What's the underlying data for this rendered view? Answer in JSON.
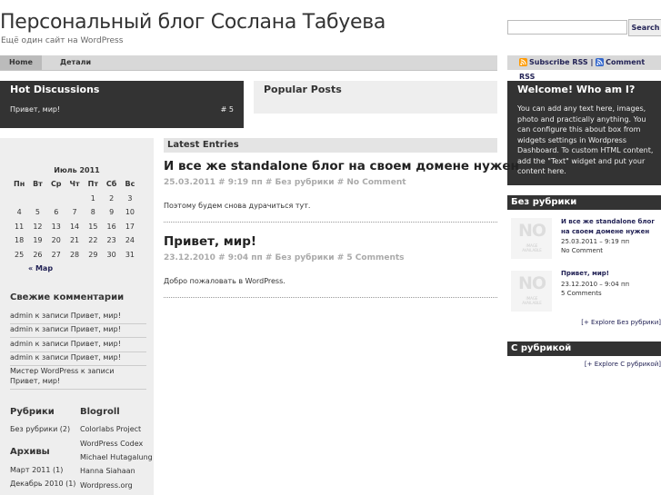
{
  "header": {
    "title": "Персональный блог Сослана Табуева",
    "description": "Ещё один сайт на WordPress"
  },
  "search": {
    "placeholder": "",
    "button": "Search"
  },
  "nav": {
    "items": [
      "Home",
      "Детали"
    ]
  },
  "rss": {
    "subscribe": "Subscribe RSS",
    "separator": "|",
    "comment": "Comment RSS"
  },
  "hot": {
    "title": "Hot Discussions",
    "items": [
      {
        "label": "Привет, мир!",
        "count": "# 5"
      }
    ]
  },
  "popular": {
    "title": "Popular Posts"
  },
  "welcome": {
    "title": "Welcome! Who am I?",
    "text": "You can add any text here, images, photo and practically anything. You can configure this about box from widgets settings in Wordpress Dashboard. To custom HTML content, add the \"Text\" widget and put your content here."
  },
  "calendar": {
    "title": "Июль 2011",
    "weekdays": [
      "Пн",
      "Вт",
      "Ср",
      "Чт",
      "Пт",
      "Сб",
      "Вс"
    ],
    "rows": [
      [
        "",
        "",
        "",
        "",
        "1",
        "2",
        "3"
      ],
      [
        "4",
        "5",
        "6",
        "7",
        "8",
        "9",
        "10"
      ],
      [
        "11",
        "12",
        "13",
        "14",
        "15",
        "16",
        "17"
      ],
      [
        "18",
        "19",
        "20",
        "21",
        "22",
        "23",
        "24"
      ],
      [
        "25",
        "26",
        "27",
        "28",
        "29",
        "30",
        "31"
      ]
    ],
    "prev": "« Мар"
  },
  "recent_comments": {
    "title": "Свежие комментарии",
    "items": [
      "admin к записи Привет, мир!",
      "admin к записи Привет, мир!",
      "admin к записи Привет, мир!",
      "admin к записи Привет, мир!",
      "Мистер WordPress к записи Привет, мир!"
    ]
  },
  "rubrics": {
    "title": "Рубрики",
    "items": [
      "Без рубрики (2)"
    ]
  },
  "archives": {
    "title": "Архивы",
    "items": [
      "Март 2011 (1)",
      "Декабрь 2010 (1)"
    ]
  },
  "blogroll": {
    "title": "Blogroll",
    "items": [
      "Colorlabs Project",
      "WordPress Codex",
      "Michael Hutagalung",
      "Hanna Siahaan",
      "Wordpress.org"
    ]
  },
  "latest": {
    "title": "Latest Entries",
    "posts": [
      {
        "title": "И все же standalone блог на своем домене нужен",
        "meta": "25.03.2011 # 9:19 пп # Без рубрики # No Comment",
        "body": "Поэтому будем снова дурачиться тут."
      },
      {
        "title": "Привет, мир!",
        "meta": "23.12.2010 # 9:04 пп # Без рубрики # 5 Comments",
        "body": "Добро пожаловать в WordPress."
      }
    ]
  },
  "cat1": {
    "title": "Без рубрики",
    "posts": [
      {
        "title": "И все же standalone блог на своем домене нужен",
        "date": "25.03.2011 – 9:19 пп",
        "comments": "No Comment"
      },
      {
        "title": "Привет, мир!",
        "date": "23.12.2010 – 9:04 пп",
        "comments": "5 Comments"
      }
    ],
    "explore": "[+ Explore Без рубрики]"
  },
  "cat2": {
    "title": "С рубрикой",
    "explore": "[+ Explore С рубрикой]"
  },
  "thumb": {
    "no": "NO",
    "image": "IMAGE",
    "available": "AVAILABLE"
  }
}
